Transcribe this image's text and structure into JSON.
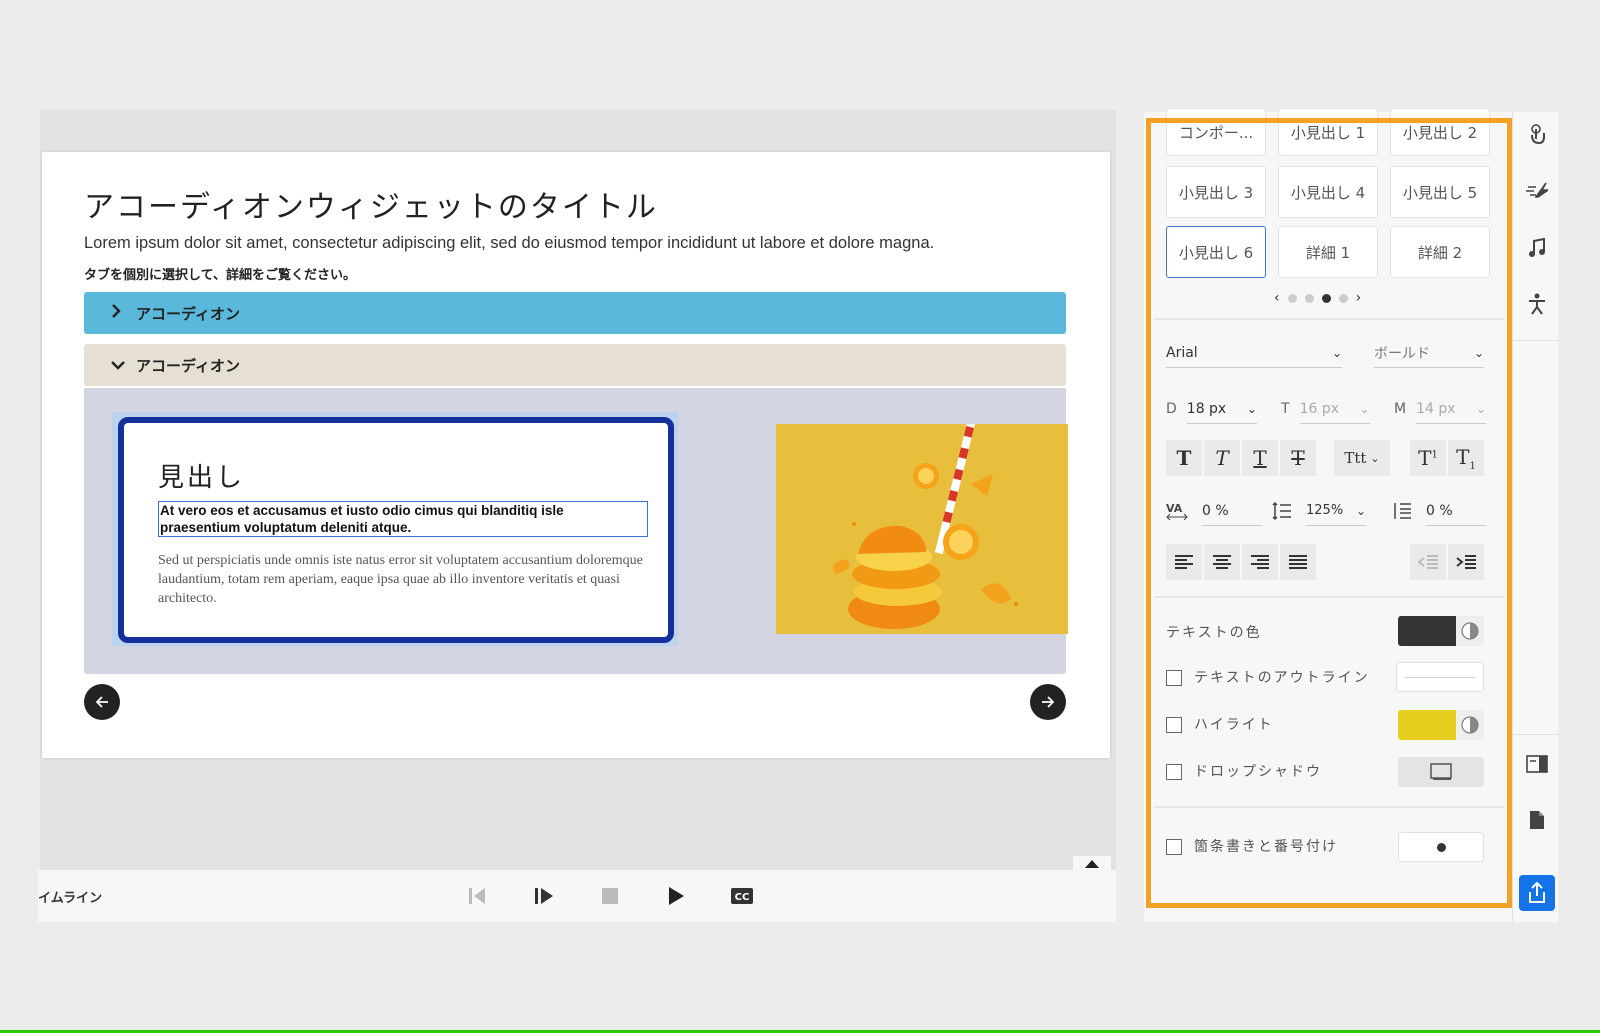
{
  "slide": {
    "title": "アコーディオンウィジェットのタイトル",
    "description": "Lorem ipsum dolor sit amet, consectetur adipiscing elit, sed do eiusmod tempor incididunt ut labore et dolore magna.",
    "instruction": "タブを個別に選択して、詳細をご覧ください。",
    "accordions": [
      {
        "label": "アコーディオン",
        "state": "collapsed"
      },
      {
        "label": "アコーディオン",
        "state": "expanded"
      }
    ],
    "card": {
      "heading": "見出し",
      "subheading": "At vero eos et accusamus et iusto odio cimus qui blanditiq isle praesentium voluptatum deleniti atque.",
      "body": "Sed ut perspiciatis unde omnis iste natus error sit voluptatem accusantium doloremque laudantium, totam rem aperiam, eaque ipsa quae ab illo inventore veritatis et quasi architecto."
    }
  },
  "timeline": {
    "label": "イムライン"
  },
  "panel": {
    "styles": [
      "コンポー...",
      "小見出し 1",
      "小見出し 2",
      "小見出し 3",
      "小見出し 4",
      "小見出し 5",
      "小見出し 6",
      "詳細 1",
      "詳細 2"
    ],
    "selected_style": "小見出し 6",
    "page_dots": 4,
    "active_dot": 3,
    "font_family": "Arial",
    "font_weight": "ボールド",
    "sizes": [
      {
        "device": "D",
        "value": "18 px"
      },
      {
        "device": "T",
        "value": "16 px"
      },
      {
        "device": "M",
        "value": "14 px"
      }
    ],
    "case_label": "Ttt",
    "letter_spacing": "0 %",
    "line_height": "125%",
    "paragraph_spacing": "0 %",
    "text_color_label": "テキストの色",
    "text_color": "#333333",
    "outline_label": "テキストのアウトライン",
    "highlight_label": "ハイライト",
    "highlight_color": "#e6cf1f",
    "shadow_label": "ドロップシャドウ",
    "bullets_label": "箇条書きと番号付け"
  },
  "colors": {
    "accent_border": "#f4a226",
    "accordion_collapsed": "#5ab9da",
    "accordion_expanded": "#e5e0d3",
    "card_border": "#15309a",
    "publish": "#1473e6"
  }
}
